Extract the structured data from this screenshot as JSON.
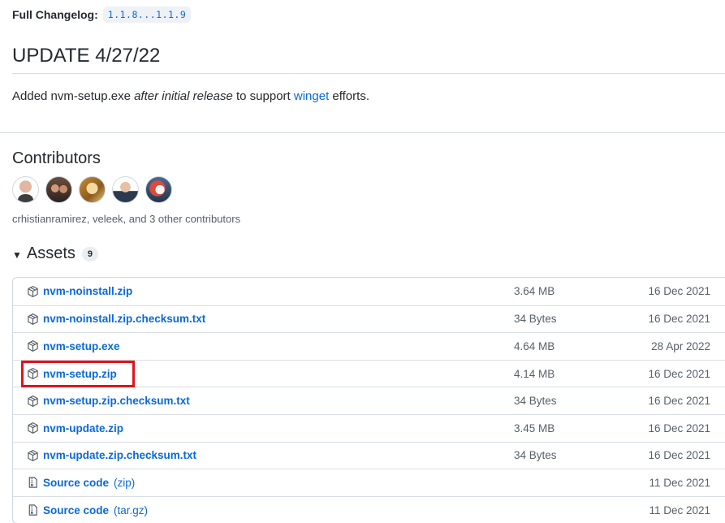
{
  "changelog": {
    "label": "Full Changelog:",
    "compare": "1.1.8...1.1.9"
  },
  "update": {
    "title": "UPDATE 4/27/22",
    "text_pre": "Added nvm-setup.exe ",
    "text_em": "after initial release",
    "text_mid": " to support ",
    "text_link": "winget",
    "text_post": " efforts."
  },
  "contributors": {
    "title": "Contributors",
    "names": "crhistianramirez, veleek, and 3 other contributors"
  },
  "assets": {
    "title": "Assets",
    "count": "9",
    "items": [
      {
        "name": "nvm-noinstall.zip",
        "size": "3.64 MB",
        "date": "16 Dec 2021",
        "icon": "package-icon"
      },
      {
        "name": "nvm-noinstall.zip.checksum.txt",
        "size": "34 Bytes",
        "date": "16 Dec 2021",
        "icon": "package-icon"
      },
      {
        "name": "nvm-setup.exe",
        "size": "4.64 MB",
        "date": "28 Apr 2022",
        "icon": "package-icon"
      },
      {
        "name": "nvm-setup.zip",
        "size": "4.14 MB",
        "date": "16 Dec 2021",
        "icon": "package-icon"
      },
      {
        "name": "nvm-setup.zip.checksum.txt",
        "size": "34 Bytes",
        "date": "16 Dec 2021",
        "icon": "package-icon"
      },
      {
        "name": "nvm-update.zip",
        "size": "3.45 MB",
        "date": "16 Dec 2021",
        "icon": "package-icon"
      },
      {
        "name": "nvm-update.zip.checksum.txt",
        "size": "34 Bytes",
        "date": "16 Dec 2021",
        "icon": "package-icon"
      },
      {
        "name": "Source code",
        "suffix": "(zip)",
        "size": "",
        "date": "11 Dec 2021",
        "icon": "file-zip-icon"
      },
      {
        "name": "Source code",
        "suffix": "(tar.gz)",
        "size": "",
        "date": "11 Dec 2021",
        "icon": "file-zip-icon"
      }
    ]
  },
  "colors": {
    "link": "#0969da",
    "highlight": "#e0121b",
    "muted": "#57606a"
  }
}
